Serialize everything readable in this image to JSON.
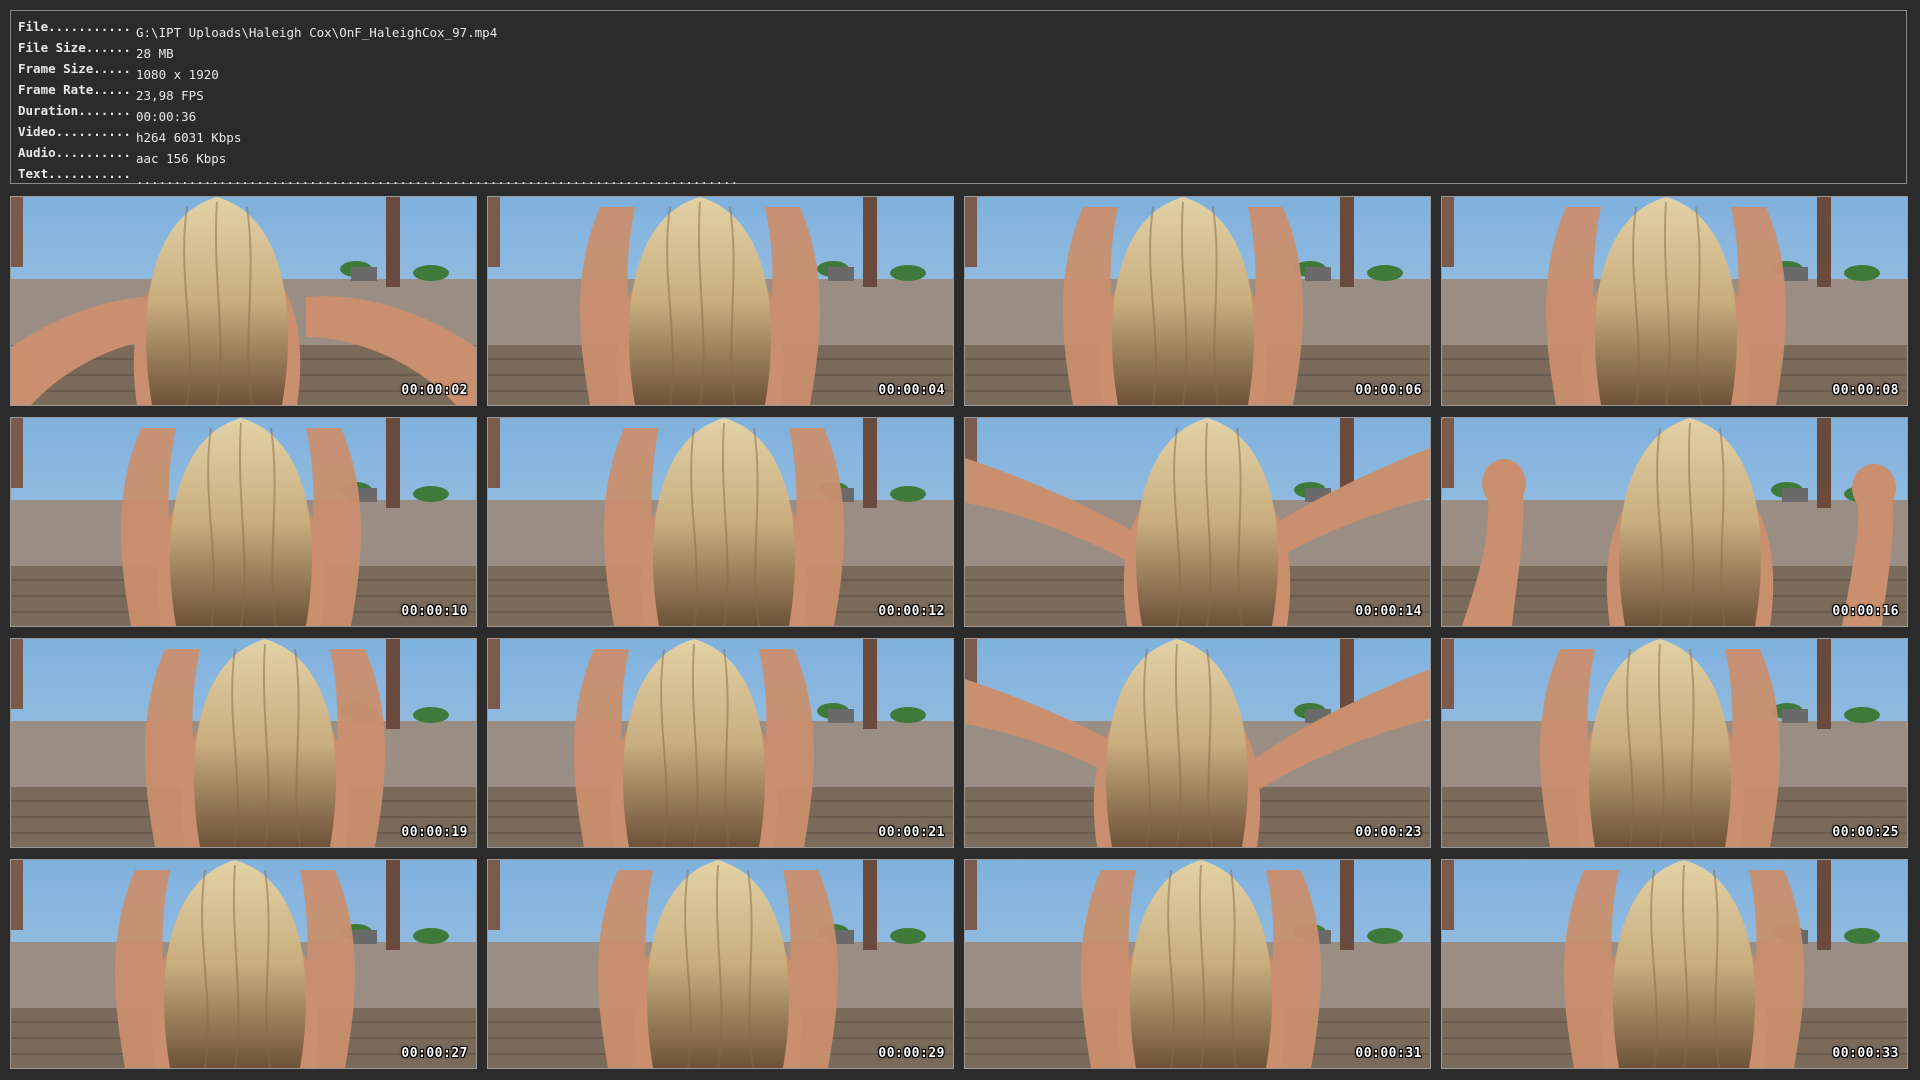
{
  "info": [
    {
      "key": "File...........",
      "value": "G:\\IPT Uploads\\Haleigh Cox\\OnF_HaleighCox_97.mp4"
    },
    {
      "key": "File Size......",
      "value": "28 MB"
    },
    {
      "key": "Frame Size.....",
      "value": "1080 x 1920"
    },
    {
      "key": "Frame Rate.....",
      "value": "23,98 FPS"
    },
    {
      "key": "Duration.......",
      "value": "00:00:36"
    },
    {
      "key": "Video..........",
      "value": "h264 6031 Kbps"
    },
    {
      "key": "Audio..........",
      "value": "aac 156 Kbps"
    },
    {
      "key": "Text...........",
      "value": "................................................................................"
    }
  ],
  "thumbnails": [
    {
      "time": "00:00:02",
      "pose": "arms-down"
    },
    {
      "time": "00:00:04",
      "pose": "arms-up"
    },
    {
      "time": "00:00:06",
      "pose": "arms-up"
    },
    {
      "time": "00:00:08",
      "pose": "arms-up"
    },
    {
      "time": "00:00:10",
      "pose": "arms-up"
    },
    {
      "time": "00:00:12",
      "pose": "arms-up"
    },
    {
      "time": "00:00:14",
      "pose": "arms-out"
    },
    {
      "time": "00:00:16",
      "pose": "fists"
    },
    {
      "time": "00:00:19",
      "pose": "arms-up"
    },
    {
      "time": "00:00:21",
      "pose": "arms-up"
    },
    {
      "time": "00:00:23",
      "pose": "arms-out"
    },
    {
      "time": "00:00:25",
      "pose": "arms-up"
    },
    {
      "time": "00:00:27",
      "pose": "arms-up"
    },
    {
      "time": "00:00:29",
      "pose": "arms-up"
    },
    {
      "time": "00:00:31",
      "pose": "arms-up"
    },
    {
      "time": "00:00:33",
      "pose": "arms-up"
    }
  ],
  "colors": {
    "background": "#2b2b2b",
    "panel_border": "#8a8a8a",
    "text": "#e8e8e8",
    "sky": "#a9c9e4",
    "wall": "#9a8e84",
    "stone": "#7a6a5a",
    "skin": "#c98f6e",
    "hair": "#c9ae7e"
  }
}
